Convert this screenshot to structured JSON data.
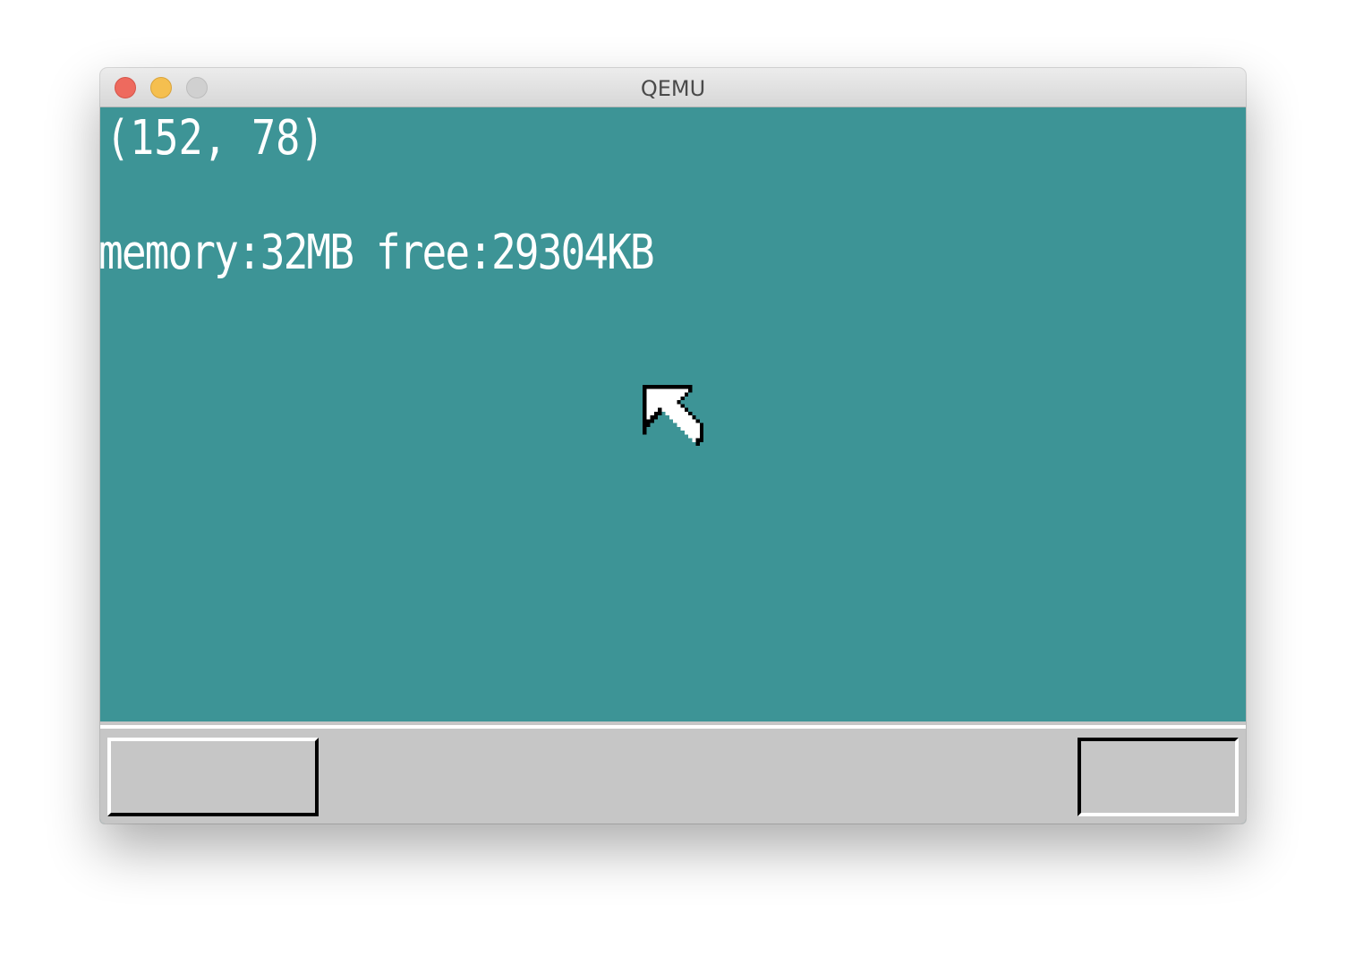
{
  "window": {
    "title": "QEMU"
  },
  "screen": {
    "background_color": "#3d9496",
    "mouse_coordinates": "(152, 78)",
    "memory_info": "memory:32MB free:29304KB"
  },
  "taskbar": {
    "background_color": "#c6c6c6"
  },
  "icons": {
    "cursor": "arrow-cursor-icon"
  }
}
